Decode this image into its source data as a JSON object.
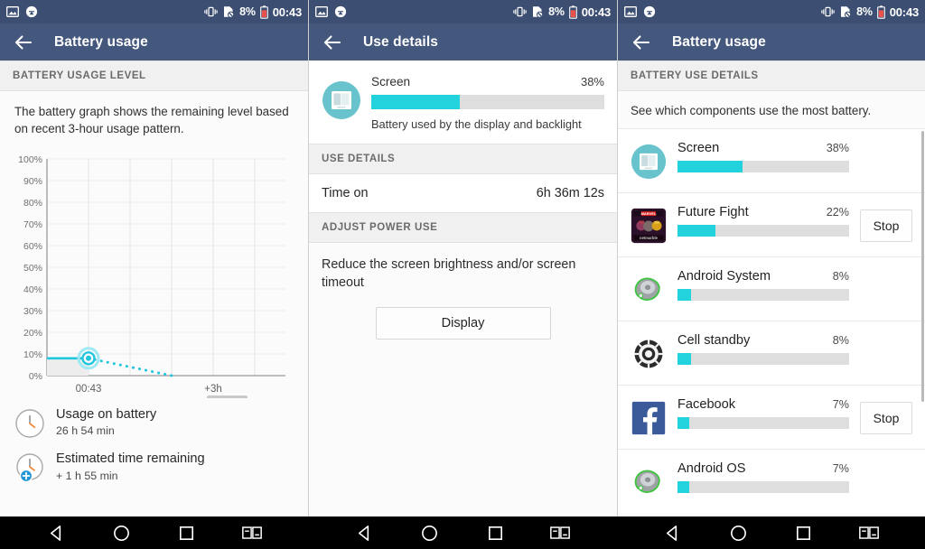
{
  "status_bar": {
    "icons_left": [
      "image-icon",
      "update-circle-icon"
    ],
    "icons_right": [
      "vibrate-icon",
      "no-sdcard-icon"
    ],
    "battery_percent": "8%",
    "battery_icon": "battery-low-icon",
    "time": "00:43",
    "bg_color": "#3c4f72"
  },
  "nav_bar": {
    "buttons": [
      "back-triangle-icon",
      "home-circle-icon",
      "recents-square-icon",
      "dual-window-icon"
    ]
  },
  "colors": {
    "action_bar": "#44577c",
    "accent_teal": "#22d2dd",
    "bar_track": "#dedede",
    "section_header_bg": "#f0f0f0"
  },
  "panel1": {
    "title": "Battery usage",
    "back_icon": "back-arrow-icon",
    "section_header": "BATTERY USAGE LEVEL",
    "description": "The battery graph shows the remaining level based on recent 3-hour usage pattern.",
    "summary": [
      {
        "icon": "clock-icon",
        "title": "Usage on battery",
        "value": "26 h 54 min"
      },
      {
        "icon": "clock-plus-icon",
        "title": "Estimated time remaining",
        "value": "+ 1 h 55 min"
      }
    ]
  },
  "panel2": {
    "title": "Use details",
    "back_icon": "back-arrow-icon",
    "screen": {
      "icon": "screen-icon",
      "name": "Screen",
      "percent": "38%",
      "percent_value": 38,
      "description": "Battery used by the display and backlight"
    },
    "use_details_header": "USE DETAILS",
    "time_on_label": "Time on",
    "time_on_value": "6h 36m 12s",
    "adjust_header": "ADJUST POWER USE",
    "adjust_text": "Reduce the screen brightness and/or screen timeout",
    "display_button": "Display"
  },
  "panel3": {
    "title": "Battery usage",
    "back_icon": "back-arrow-icon",
    "section_header": "BATTERY USE DETAILS",
    "intro": "See which components use the most battery.",
    "stop_label": "Stop",
    "apps": [
      {
        "icon": "screen-icon",
        "name": "Screen",
        "percent": "38%",
        "percent_value": 38,
        "has_stop": false
      },
      {
        "icon": "future-fight-icon",
        "name": "Future Fight",
        "percent": "22%",
        "percent_value": 22,
        "has_stop": true
      },
      {
        "icon": "android-icon",
        "name": "Android System",
        "percent": "8%",
        "percent_value": 8,
        "has_stop": false
      },
      {
        "icon": "cell-standby-icon",
        "name": "Cell standby",
        "percent": "8%",
        "percent_value": 8,
        "has_stop": false
      },
      {
        "icon": "facebook-icon",
        "name": "Facebook",
        "percent": "7%",
        "percent_value": 7,
        "has_stop": true
      },
      {
        "icon": "android-icon",
        "name": "Android OS",
        "percent": "7%",
        "percent_value": 7,
        "has_stop": false
      }
    ]
  },
  "chart_data": {
    "type": "line",
    "title": "Battery usage level",
    "xlabel": "",
    "ylabel": "",
    "ylim": [
      0,
      100
    ],
    "yticks": [
      "0%",
      "10%",
      "20%",
      "30%",
      "40%",
      "50%",
      "60%",
      "70%",
      "80%",
      "90%",
      "100%"
    ],
    "xticks": [
      "00:43",
      "+3h"
    ],
    "grid": true,
    "series": [
      {
        "name": "Battery level (past)",
        "style": "solid",
        "color": "#22c6dd",
        "points": [
          {
            "x": 0,
            "y": 8
          },
          {
            "x": 0.175,
            "y": 8
          }
        ]
      },
      {
        "name": "Projected level",
        "style": "dotted",
        "color": "#22c6dd",
        "points": [
          {
            "x": 0.175,
            "y": 8
          },
          {
            "x": 0.5,
            "y": 0
          }
        ]
      }
    ],
    "marker": {
      "x": 0.175,
      "y": 8,
      "label": "00:43",
      "color": "#22c6dd"
    },
    "annotations": []
  }
}
